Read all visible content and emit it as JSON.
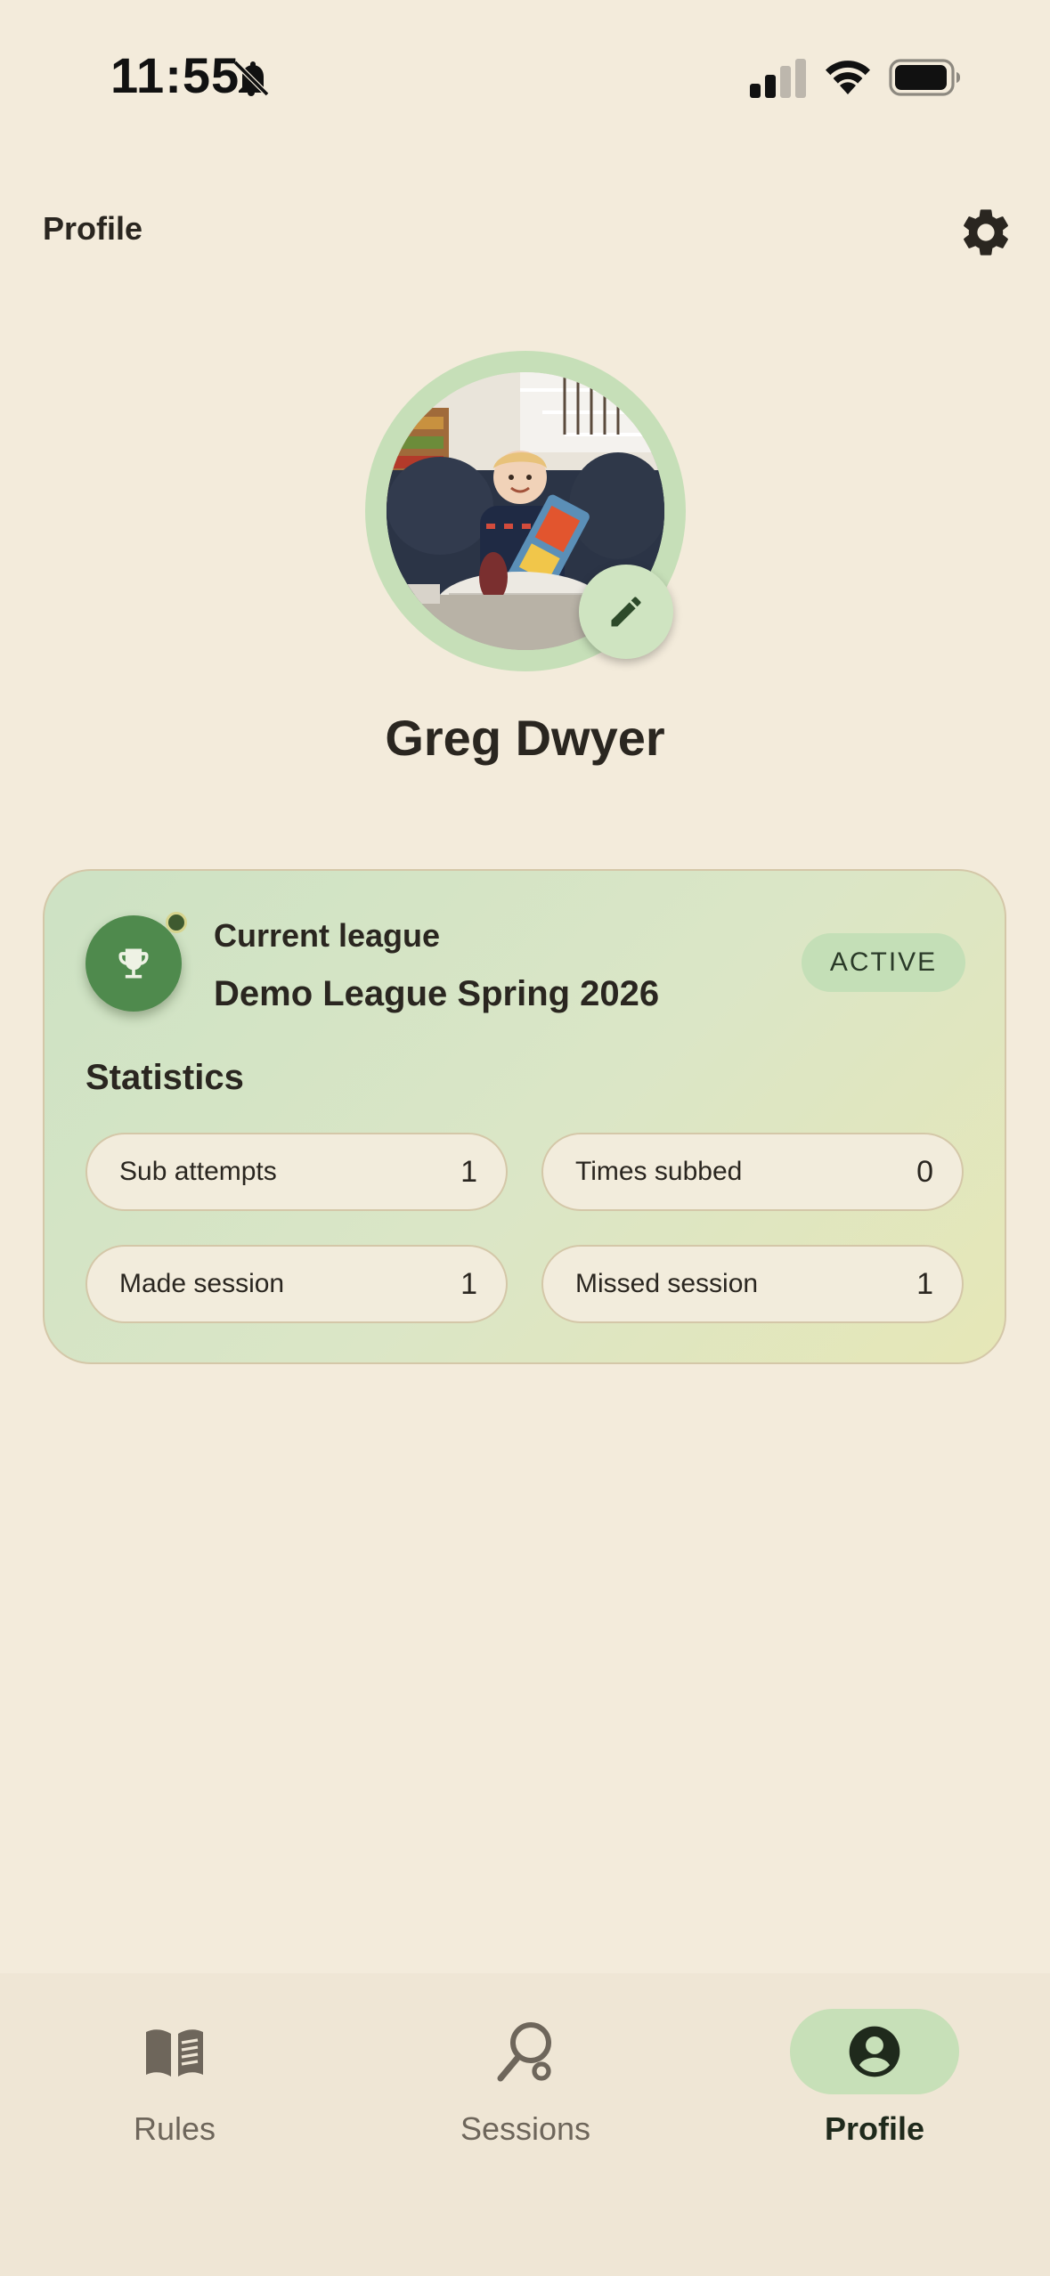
{
  "status_bar": {
    "time": "11:55"
  },
  "header": {
    "title": "Profile"
  },
  "profile": {
    "name": "Greg Dwyer"
  },
  "league_card": {
    "label": "Current league",
    "name": "Demo League Spring 2026",
    "status": "ACTIVE"
  },
  "statistics": {
    "title": "Statistics",
    "items": [
      {
        "label": "Sub attempts",
        "value": "1"
      },
      {
        "label": "Times subbed",
        "value": "0"
      },
      {
        "label": "Made session",
        "value": "1"
      },
      {
        "label": "Missed session",
        "value": "1"
      }
    ]
  },
  "bottom_nav": {
    "items": [
      {
        "label": "Rules",
        "icon": "book-icon",
        "active": false
      },
      {
        "label": "Sessions",
        "icon": "racket-icon",
        "active": false
      },
      {
        "label": "Profile",
        "icon": "account-circle-icon",
        "active": true
      }
    ]
  },
  "colors": {
    "background": "#f3ebdb",
    "accent": "#c7e0b8",
    "trophy_badge": "#4f8a4d"
  }
}
